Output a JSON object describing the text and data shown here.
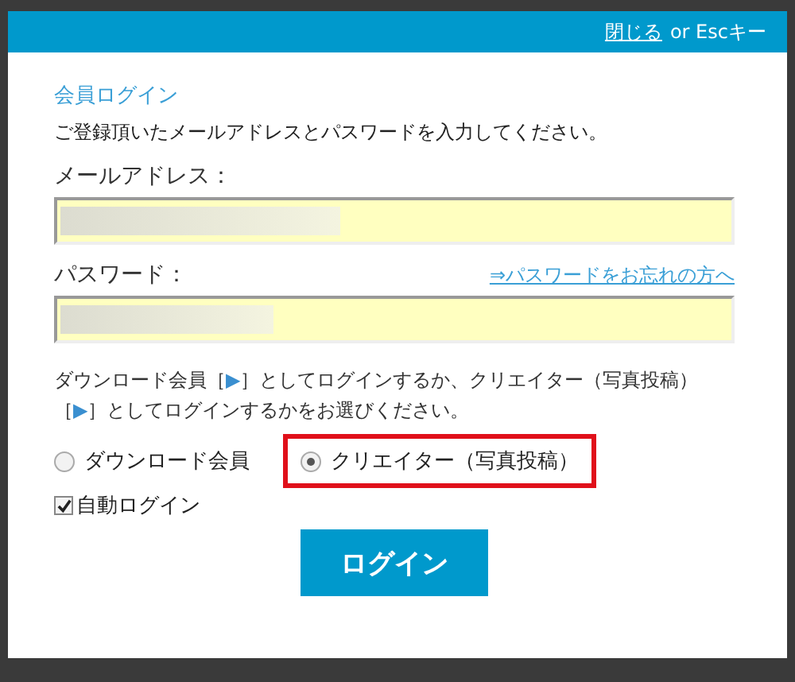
{
  "header": {
    "close_link": "閉じる",
    "close_hint": "or Escキー"
  },
  "title": "会員ログイン",
  "intro": "ご登録頂いたメールアドレスとパスワードを入力してください。",
  "fields": [
    {
      "label": "メールアドレス：",
      "autofilled": true
    },
    {
      "label": "パスワード：",
      "link": "⇒パスワードをお忘れの方へ",
      "autofilled": true
    }
  ],
  "instruction": [
    {
      "kind": "text",
      "text": "ダウンロード会員［"
    },
    {
      "kind": "marker",
      "text": "▶"
    },
    {
      "kind": "text",
      "text": "］としてログインするか、クリエイター（写真投稿）［"
    },
    {
      "kind": "marker",
      "text": "▶"
    },
    {
      "kind": "text",
      "text": "］としてログインするかをお選びください。"
    }
  ],
  "account_types": [
    {
      "label": "ダウンロード会員",
      "selected": false,
      "highlighted": false
    },
    {
      "label": "クリエイター（写真投稿）",
      "selected": true,
      "highlighted": true
    }
  ],
  "auto_login": {
    "label": "自動ログイン",
    "checked": true
  },
  "submit": "ログイン"
}
